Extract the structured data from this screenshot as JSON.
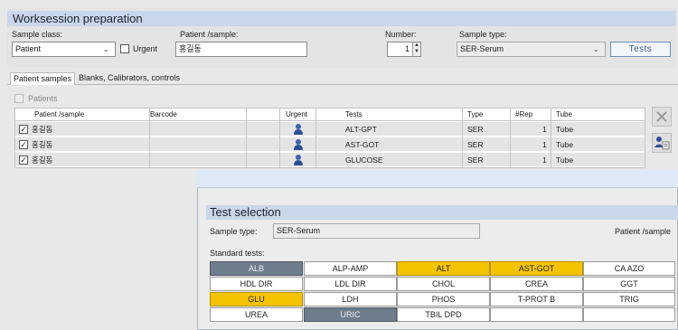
{
  "worksession": {
    "title": "Worksession preparation",
    "sample_class_label": "Sample class:",
    "sample_class_value": "Patient",
    "urgent_label": "Urgent",
    "urgent_checked": false,
    "patient_sample_label": "Patient /sample:",
    "patient_sample_value": "홍길동",
    "number_label": "Number:",
    "number_value": "1",
    "sample_type_label": "Sample type:",
    "sample_type_value": "SER-Serum",
    "tests_button": "Tests"
  },
  "tabs": [
    {
      "label": "Patient samples",
      "active": true
    },
    {
      "label": "Blanks, Calibrators, controls",
      "active": false
    }
  ],
  "patients_group": {
    "label": "Patients",
    "checked": false
  },
  "grid": {
    "columns": [
      "Patient /sample",
      "Barcode",
      "Urgent",
      "Tests",
      "Type",
      "#Rep",
      "Tube"
    ],
    "rows": [
      {
        "checked": true,
        "patient": "홍길동",
        "barcode": "",
        "urgent_icon": "person-icon",
        "test": "ALT-GPT",
        "type": "SER",
        "rep": "1",
        "tube": "Tube"
      },
      {
        "checked": true,
        "patient": "홍길동",
        "barcode": "",
        "urgent_icon": "person-icon",
        "test": "AST-GOT",
        "type": "SER",
        "rep": "1",
        "tube": "Tube"
      },
      {
        "checked": true,
        "patient": "홍길동",
        "barcode": "",
        "urgent_icon": "person-icon",
        "test": "GLUCOSE",
        "type": "SER",
        "rep": "1",
        "tube": "Tube"
      }
    ]
  },
  "side_buttons": [
    {
      "icon": "delete-x-icon"
    },
    {
      "icon": "patient-list-icon"
    }
  ],
  "test_selection": {
    "title": "Test selection",
    "sample_type_label": "Sample type:",
    "sample_type_value": "SER-Serum",
    "patient_sample_label": "Patient /sample",
    "standard_tests_label": "Standard tests:",
    "tests": [
      [
        {
          "label": "ALB",
          "state": "slate"
        },
        {
          "label": "ALP-AMP",
          "state": "none"
        },
        {
          "label": "ALT",
          "state": "yellow"
        },
        {
          "label": "AST-GOT",
          "state": "yellow"
        },
        {
          "label": "CA AZO",
          "state": "none"
        }
      ],
      [
        {
          "label": "HDL DIR",
          "state": "none"
        },
        {
          "label": "LDL DIR",
          "state": "none"
        },
        {
          "label": "CHOL",
          "state": "none"
        },
        {
          "label": "CREA",
          "state": "none"
        },
        {
          "label": "GGT",
          "state": "none"
        }
      ],
      [
        {
          "label": "GLU",
          "state": "yellow"
        },
        {
          "label": "LDH",
          "state": "none"
        },
        {
          "label": "PHOS",
          "state": "none"
        },
        {
          "label": "T-PROT B",
          "state": "none"
        },
        {
          "label": "TRIG",
          "state": "none"
        }
      ],
      [
        {
          "label": "UREA",
          "state": "none"
        },
        {
          "label": "URIC",
          "state": "slate"
        },
        {
          "label": "TBIL DPD",
          "state": "none"
        },
        {
          "label": "",
          "state": "none"
        },
        {
          "label": "",
          "state": "none"
        }
      ]
    ]
  },
  "colors": {
    "header_band": "#c9d7ea",
    "selected_yellow": "#f5c400",
    "selected_slate": "#6e7d8c",
    "tests_button_text": "#3a5f92"
  }
}
